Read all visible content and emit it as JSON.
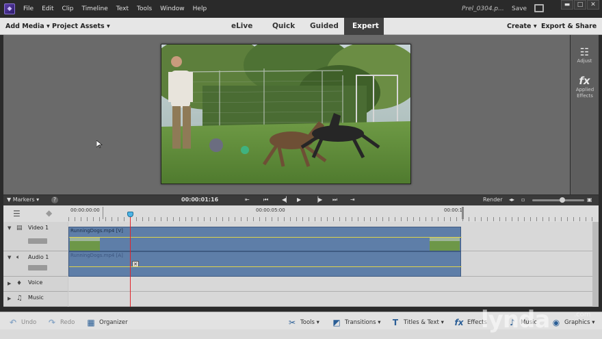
{
  "menubar": {
    "items": [
      "File",
      "Edit",
      "Clip",
      "Timeline",
      "Text",
      "Tools",
      "Window",
      "Help"
    ],
    "project_name": "Prel_0304.p...",
    "save_label": "Save"
  },
  "toolbar": {
    "add_media": "Add Media",
    "project_assets": "Project Assets",
    "modes": [
      "eLive",
      "Quick",
      "Guided",
      "Expert"
    ],
    "active_mode": "Expert",
    "create": "Create",
    "export_share": "Export & Share"
  },
  "right_panel": {
    "adjust": "Adjust",
    "applied_effects": "Applied Effects"
  },
  "transport": {
    "markers": "Markers",
    "timecode": "00:00:01:16",
    "render": "Render"
  },
  "timeline": {
    "ruler_times": [
      "00:00:00:00",
      "00:00:05:00",
      "00:00:1"
    ],
    "tracks": [
      {
        "name": "Video 1",
        "clip": "RunningDogs.mp4 [V]"
      },
      {
        "name": "Audio 1",
        "clip": "RunningDogs.mp4 [A]"
      },
      {
        "name": "Voice"
      },
      {
        "name": "Music"
      }
    ]
  },
  "bottombar": {
    "undo": "Undo",
    "redo": "Redo",
    "organizer": "Organizer",
    "tools": "Tools",
    "transitions": "Transitions",
    "titles_text": "Titles & Text",
    "effects": "Effects",
    "music": "Music",
    "graphics": "Graphics"
  },
  "watermark": {
    "brand": "lynda",
    "suffix": ".com"
  },
  "colors": {
    "accent_blue": "#4db3e6",
    "clip_blue": "#5e7ea8",
    "playhead_red": "#e0242a",
    "active_tab": "#404040"
  }
}
